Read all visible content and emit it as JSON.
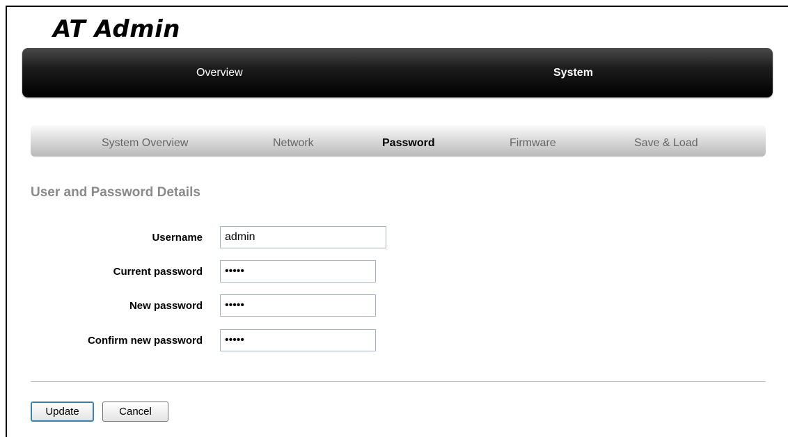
{
  "app": {
    "title": "AT Admin"
  },
  "main_nav": {
    "tabs": [
      {
        "label": "Overview",
        "active": false
      },
      {
        "label": "System",
        "active": true
      }
    ]
  },
  "sub_nav": {
    "tabs": [
      {
        "label": "System Overview",
        "active": false
      },
      {
        "label": "Network",
        "active": false
      },
      {
        "label": "Password",
        "active": true
      },
      {
        "label": "Firmware",
        "active": false
      },
      {
        "label": "Save & Load",
        "active": false
      }
    ]
  },
  "form": {
    "heading": "User and Password Details",
    "username": {
      "label": "Username",
      "value": "admin"
    },
    "current_password": {
      "label": "Current password",
      "value": "•••••"
    },
    "new_password": {
      "label": "New password",
      "value": "•••••"
    },
    "confirm_password": {
      "label": "Confirm new password",
      "value": "•••••"
    }
  },
  "actions": {
    "update_label": "Update",
    "cancel_label": "Cancel"
  },
  "colors": {
    "nav_bar": "#000000",
    "heading": "#8a8a8a",
    "input_border": "#a3b3c8"
  }
}
